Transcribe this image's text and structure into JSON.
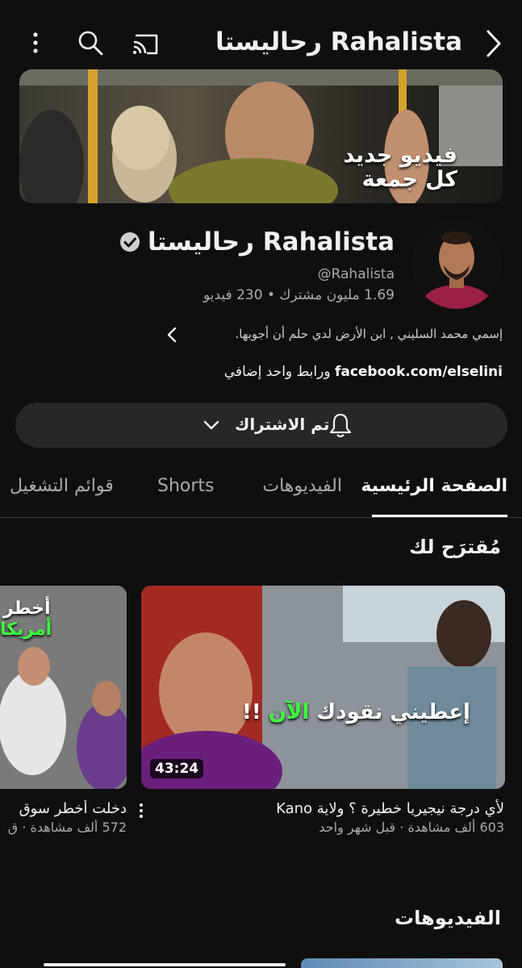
{
  "topbar": {
    "title": "رحاليستا Rahalista",
    "icons": [
      "back-chevron-icon",
      "cast-icon",
      "search-icon",
      "more-vert-icon"
    ]
  },
  "banner": {
    "text_line1": "فيديو جديد",
    "text_line2": "كل جمعة"
  },
  "channel": {
    "name": "رحاليستا Rahalista",
    "handle": "@Rahalista",
    "stats": "1.69 مليون مشترك • 230 فيديو",
    "description": "إسمي محمد السليني , ابن الأرض لدي حلم أن أجوبها.",
    "link": "facebook.com/elselini",
    "link_extra": "ورابط واحد إضافي"
  },
  "subscribe": {
    "label": "تم الاشتراك"
  },
  "tabs": [
    {
      "label": "الصفحة الرئيسية",
      "active": true
    },
    {
      "label": "الفيديوهات",
      "active": false
    },
    {
      "label": "Shorts",
      "active": false
    },
    {
      "label": "قوائم التشغيل",
      "active": false
    }
  ],
  "recommended": {
    "title": "مُقترَح لك",
    "videos": [
      {
        "title": "لأي درجة نيجيريا خطيرة ؟ ولاية Kano",
        "meta": "603 ألف مشاهدة · قبل شهر واحد",
        "duration": "43:24",
        "thumb_text": "إعطيني نقودك الآن !!",
        "thumb_text_highlight": "الآن"
      },
      {
        "title": "دخلت أخطر سوق",
        "meta": "572 ألف مشاهدة · ق",
        "thumb_text1": "أخطر",
        "thumb_text2": "أمريكا"
      }
    ]
  },
  "videos_section": {
    "title": "الفيديوهات"
  },
  "colors": {
    "background": "#0f0f0f",
    "secondary_text": "#aaaaaa",
    "button_bg": "#272727",
    "highlight_green": "#3cff3c"
  }
}
